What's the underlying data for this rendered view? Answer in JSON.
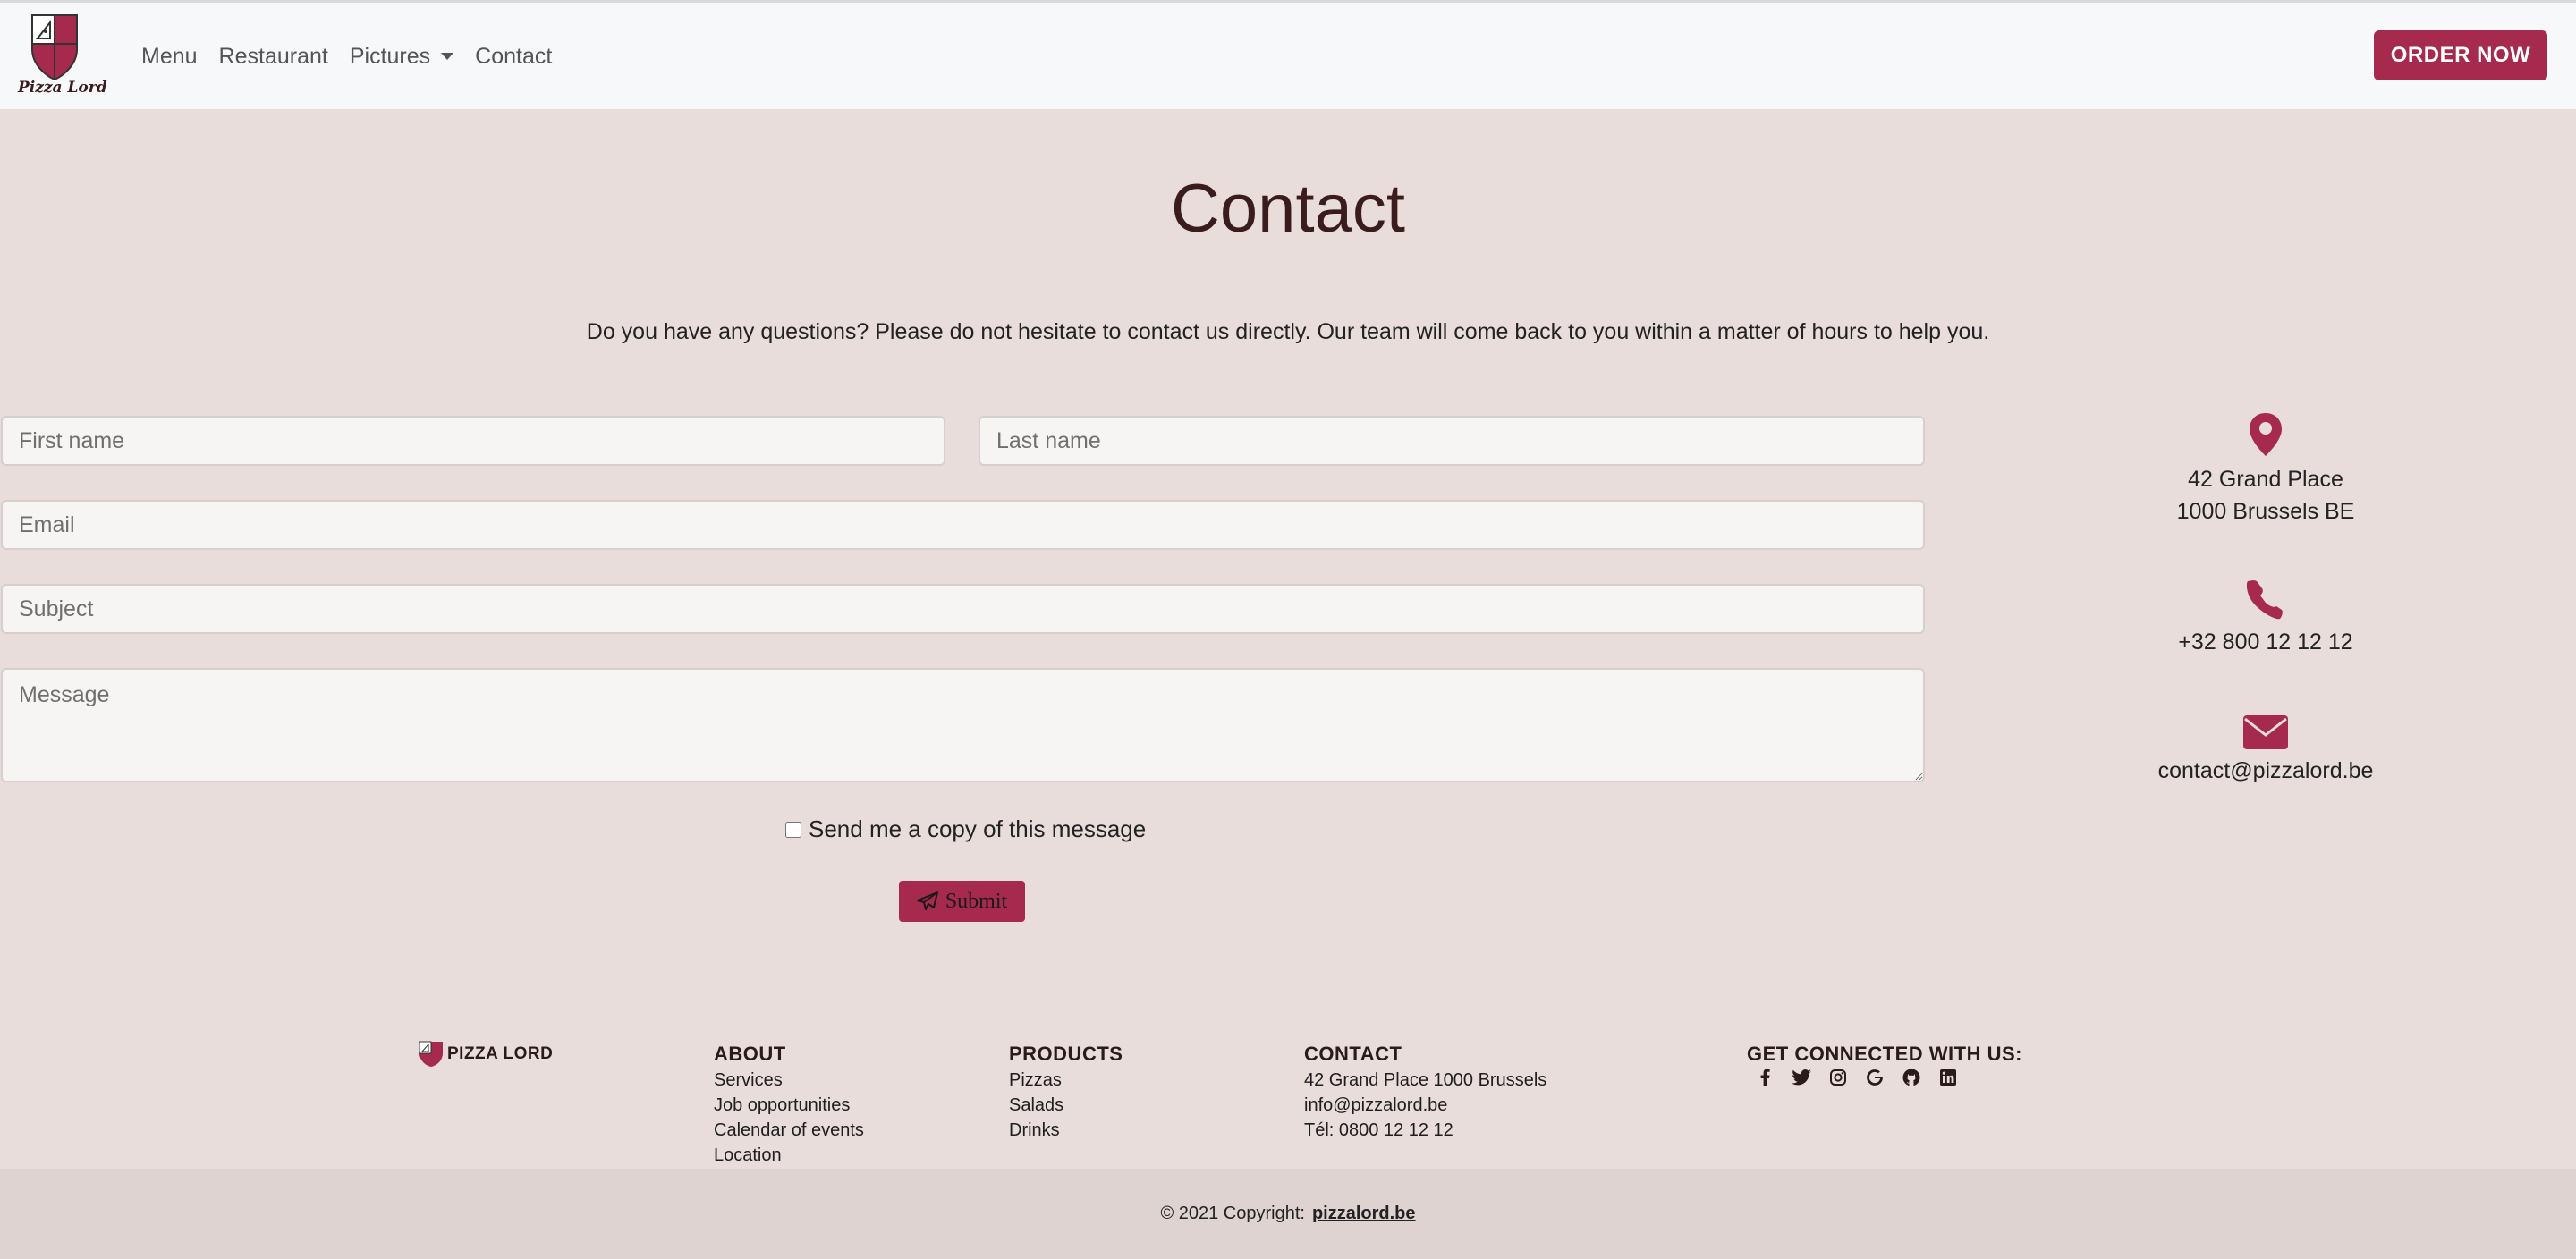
{
  "nav": {
    "brand_name": "Pizza Lord",
    "links": [
      "Menu",
      "Restaurant",
      "Pictures",
      "Contact"
    ],
    "order_button": "ORDER NOW"
  },
  "main": {
    "title": "Contact",
    "intro": "Do you have any questions? Please do not hesitate to contact us directly. Our team will come back to you within a matter of hours to help you.",
    "form": {
      "first_name_placeholder": "First name",
      "last_name_placeholder": "Last name",
      "email_placeholder": "Email",
      "subject_placeholder": "Subject",
      "message_placeholder": "Message",
      "copy_label": "Send me a copy of this message",
      "submit_label": "Submit"
    },
    "info": {
      "address_line1": "42 Grand Place",
      "address_line2": "1000 Brussels BE",
      "phone": "+32 800 12 12 12",
      "email": "contact@pizzalord.be"
    }
  },
  "footer": {
    "brand": "PIZZA LORD",
    "about": {
      "heading": "ABOUT",
      "items": [
        "Services",
        "Job opportunities",
        "Calendar of events",
        "Location"
      ]
    },
    "products": {
      "heading": "PRODUCTS",
      "items": [
        "Pizzas",
        "Salads",
        "Drinks"
      ]
    },
    "contact": {
      "heading": "CONTACT",
      "items": [
        "42 Grand Place 1000 Brussels",
        "info@pizzalord.be",
        "Tél: 0800 12 12 12"
      ]
    },
    "social": {
      "heading": "GET CONNECTED WITH US:",
      "icons": [
        "facebook-icon",
        "twitter-icon",
        "instagram-icon",
        "google-icon",
        "github-icon",
        "linkedin-icon"
      ]
    },
    "copyright_text": "© 2021 Copyright:",
    "copyright_link": "pizzalord.be"
  },
  "colors": {
    "accent": "#a52a4d",
    "background": "#e8dddb",
    "navbar": "#f7f8f9",
    "footer_bar": "#dfd3d1"
  }
}
